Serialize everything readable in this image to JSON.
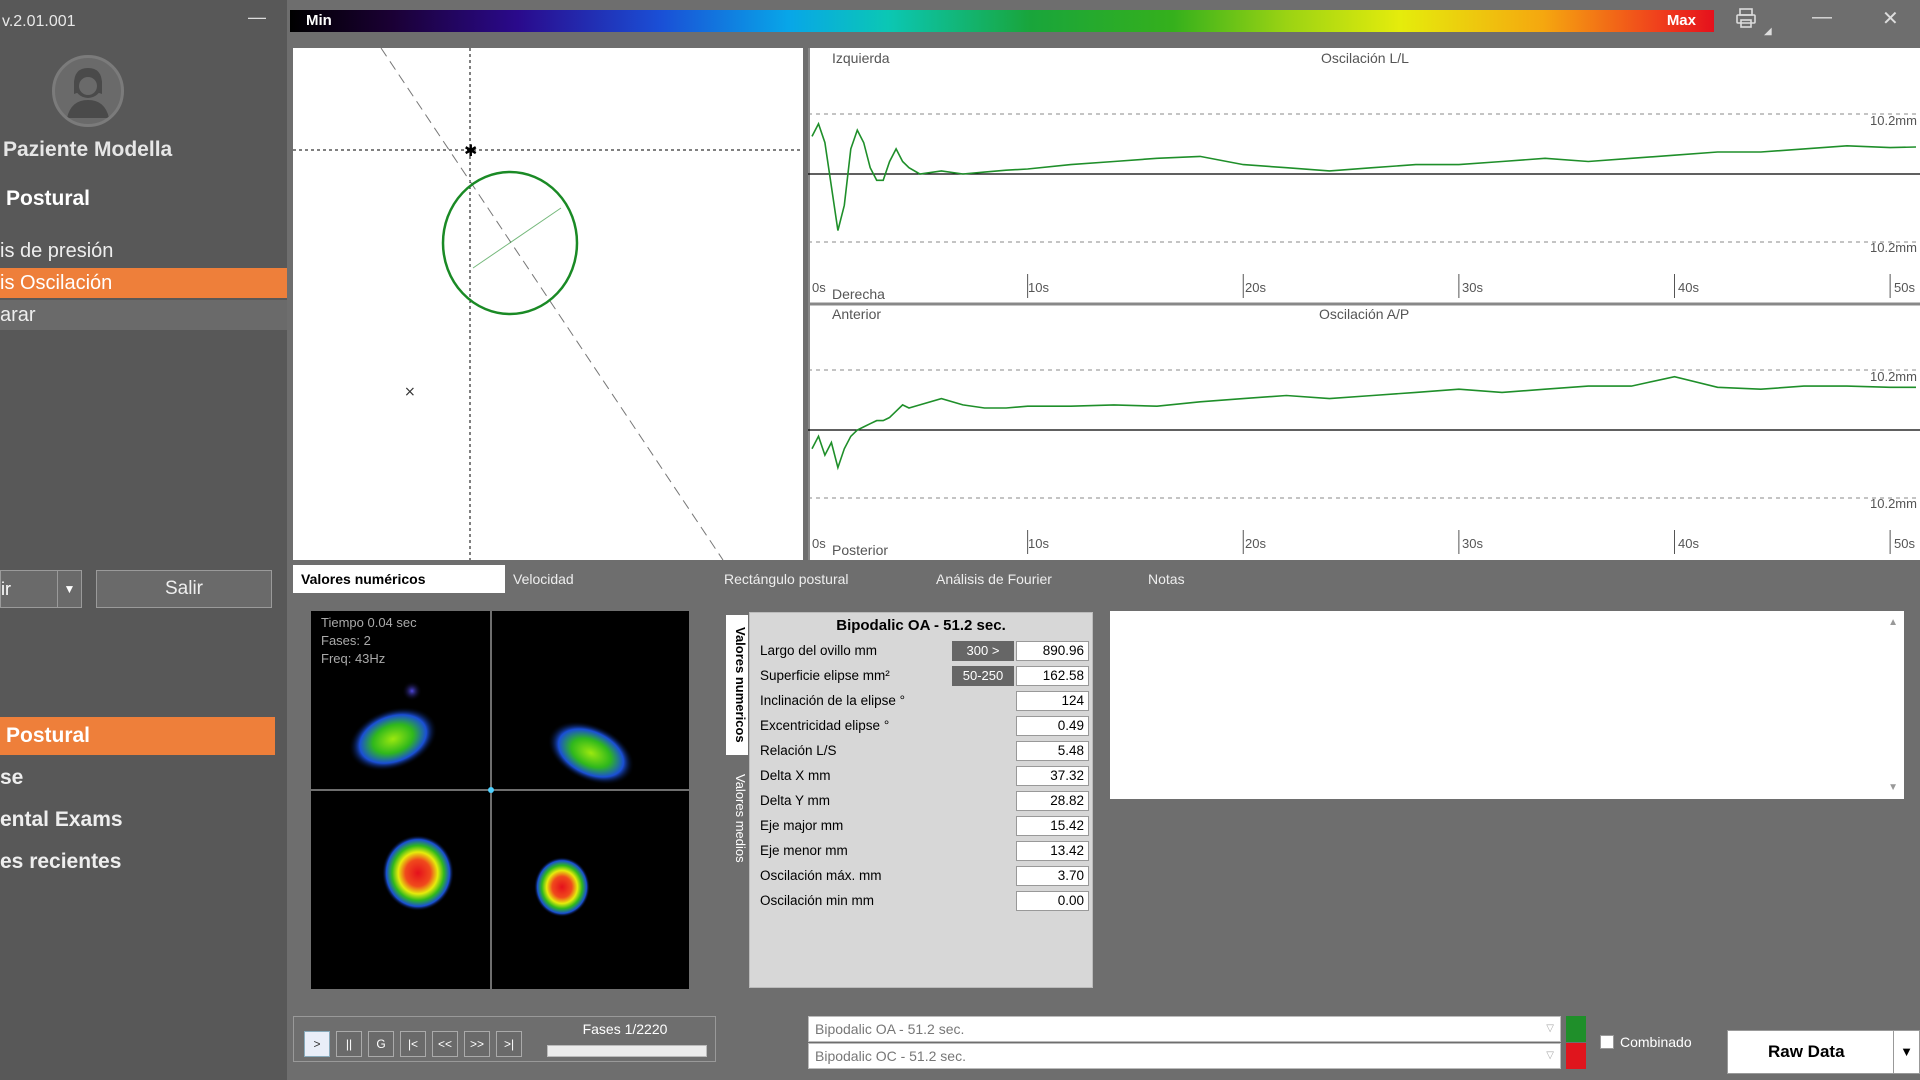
{
  "app": {
    "version": "v.2.01.001"
  },
  "sidebar": {
    "patient_name": "Paziente Modella",
    "module_title": "Postural",
    "items": [
      {
        "label": "is de presión",
        "active": false
      },
      {
        "label": "is Oscilación",
        "active": true
      },
      {
        "label": "arar",
        "active": false
      }
    ],
    "split_button_label": "ir",
    "exit_button_label": "Salir",
    "nav": [
      {
        "label": "Postural",
        "active": true
      },
      {
        "label": "se",
        "active": false
      },
      {
        "label": "ental Exams",
        "active": false
      },
      {
        "label": "es recientes",
        "active": false
      }
    ]
  },
  "colorbar": {
    "min_label": "Min",
    "max_label": "Max"
  },
  "charts": {
    "ll": {
      "top_label": "Izquierda",
      "title": "Oscilación L/L",
      "bottom_label": "Derecha",
      "limit_label": "10.2mm"
    },
    "ap": {
      "top_label": "Anterior",
      "title": "Oscilación A/P",
      "bottom_label": "Posterior",
      "limit_label": "10.2mm"
    },
    "ticks": [
      "0s",
      "10s",
      "20s",
      "30s",
      "40s",
      "50s"
    ]
  },
  "chart_data": [
    {
      "type": "line",
      "title": "Oscilación L/L",
      "x": [
        0,
        0.3,
        0.6,
        0.9,
        1.2,
        1.5,
        1.8,
        2.1,
        2.4,
        2.7,
        3.0,
        3.3,
        3.6,
        3.9,
        4.2,
        4.5,
        5,
        6,
        7,
        8,
        9,
        10,
        12,
        14,
        16,
        18,
        20,
        22,
        24,
        26,
        28,
        30,
        32,
        34,
        36,
        38,
        40,
        42,
        44,
        46,
        48,
        50,
        51.2
      ],
      "series": [
        {
          "values": [
            6,
            8,
            5,
            -2,
            -9,
            -5,
            4,
            7,
            5,
            1,
            -1,
            -1,
            2,
            4,
            2,
            1,
            0,
            0.5,
            0,
            0.3,
            0.6,
            0.8,
            1.5,
            2,
            2.5,
            2.8,
            1.5,
            1,
            0.5,
            1,
            1.5,
            1.5,
            2,
            2.5,
            2,
            2.5,
            3,
            3.5,
            3.5,
            4,
            4.5,
            4.2,
            4.3
          ]
        }
      ],
      "ylim": [
        -10.2,
        10.2
      ],
      "xlim": [
        0,
        51.2
      ]
    },
    {
      "type": "line",
      "title": "Oscilación A/P",
      "x": [
        0,
        0.3,
        0.6,
        0.9,
        1.2,
        1.5,
        1.8,
        2.1,
        2.4,
        2.7,
        3.0,
        3.3,
        3.6,
        3.9,
        4.2,
        4.5,
        5,
        6,
        7,
        8,
        9,
        10,
        12,
        14,
        16,
        18,
        20,
        22,
        24,
        26,
        28,
        30,
        32,
        34,
        36,
        38,
        40,
        42,
        44,
        46,
        48,
        50,
        51.2
      ],
      "series": [
        {
          "values": [
            -3,
            -1,
            -4,
            -2,
            -6,
            -3,
            -1,
            0,
            0.5,
            1,
            1.5,
            1.5,
            2,
            3,
            4,
            3.5,
            4,
            5,
            4,
            3.5,
            3.5,
            3.8,
            3.8,
            4,
            3.8,
            4.5,
            5,
            5.5,
            5,
            5.5,
            6,
            6.5,
            6,
            6.5,
            7,
            7,
            8.5,
            6.8,
            6.5,
            7,
            7,
            6.8,
            6.8
          ]
        }
      ],
      "ylim": [
        -10.2,
        10.2
      ],
      "xlim": [
        0,
        51.2
      ]
    }
  ],
  "tabs": [
    {
      "label": "Valores numéricos",
      "active": true
    },
    {
      "label": "Velocidad",
      "active": false
    },
    {
      "label": "Rectángulo postural",
      "active": false
    },
    {
      "label": "Análisis de Fourier",
      "active": false
    },
    {
      "label": "Notas",
      "active": false
    }
  ],
  "heatmap": {
    "time": "Tiempo 0.04 sec",
    "phases": "Fases: 2",
    "freq": "Freq: 43Hz"
  },
  "vertical_tabs": [
    {
      "label": "Valores numericos",
      "active": true
    },
    {
      "label": "Valores medios",
      "active": false
    }
  ],
  "values_table": {
    "title": "Bipodalic OA - 51.2 sec.",
    "rows": [
      {
        "label": "Largo del ovillo mm",
        "range": "300 >",
        "value": "890.96"
      },
      {
        "label": "Superficie elipse mm²",
        "range": "50-250",
        "value": "162.58"
      },
      {
        "label": "Inclinación de la elipse °",
        "range": "",
        "value": "124"
      },
      {
        "label": "Excentricidad elipse °",
        "range": "",
        "value": "0.49"
      },
      {
        "label": "Relación L/S",
        "range": "",
        "value": "5.48"
      },
      {
        "label": "Delta X mm",
        "range": "",
        "value": "37.32"
      },
      {
        "label": "Delta Y mm",
        "range": "",
        "value": "28.82"
      },
      {
        "label": "Eje major mm",
        "range": "",
        "value": "15.42"
      },
      {
        "label": "Eje menor mm",
        "range": "",
        "value": "13.42"
      },
      {
        "label": "Oscilación máx. mm",
        "range": "",
        "value": "3.70"
      },
      {
        "label": "Oscilación min mm",
        "range": "",
        "value": "0.00"
      }
    ]
  },
  "player": {
    "buttons": [
      ">",
      "||",
      "G",
      "|<",
      "<<",
      ">>",
      ">|"
    ],
    "phases_label": "Fases 1/2220"
  },
  "selectors": [
    {
      "value": "Bipodalic OA - 51.2 sec.",
      "color": "#1f8f2a"
    },
    {
      "value": "Bipodalic OC - 51.2 sec.",
      "color": "#e0151d"
    }
  ],
  "combined_label": "Combinado",
  "raw_data_label": "Raw Data"
}
